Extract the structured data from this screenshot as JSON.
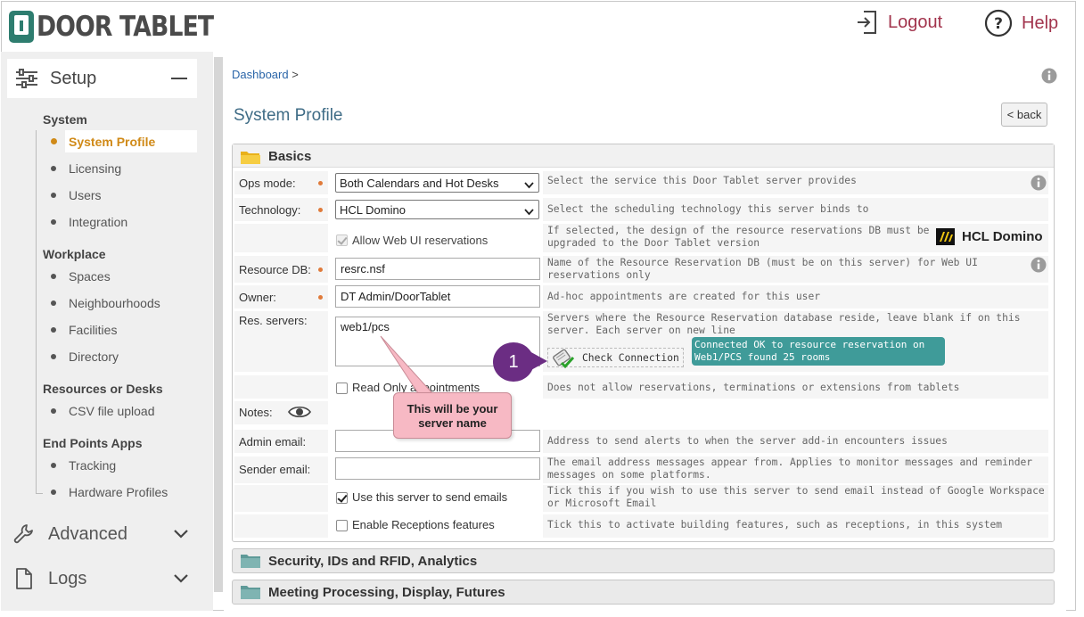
{
  "header": {
    "logo_text": "DOOR TABLET",
    "logout_label": "Logout",
    "help_label": "Help"
  },
  "sidebar": {
    "setup_label": "Setup",
    "sections": [
      {
        "label": "System",
        "items": [
          "System Profile",
          "Licensing",
          "Users",
          "Integration"
        ]
      },
      {
        "label": "Workplace",
        "items": [
          "Spaces",
          "Neighbourhoods",
          "Facilities",
          "Directory"
        ]
      },
      {
        "label": "Resources or Desks",
        "items": [
          "CSV file upload"
        ]
      },
      {
        "label": "End Points Apps",
        "items": [
          "Tracking",
          "Hardware Profiles"
        ]
      }
    ],
    "active_item": "System Profile",
    "advanced_label": "Advanced",
    "logs_label": "Logs"
  },
  "main": {
    "breadcrumb": "Dashboard",
    "breadcrumb_sep": ">",
    "page_title": "System Profile",
    "back_label": "< back",
    "basics_title": "Basics",
    "fields": {
      "ops_mode": {
        "label": "Ops mode:",
        "value": "Both Calendars and Hot Desks",
        "help": "Select the service this Door Tablet server provides"
      },
      "technology": {
        "label": "Technology:",
        "value": "HCL Domino",
        "help": "Select the scheduling technology this server binds to"
      },
      "allow_web": {
        "label": "Allow Web UI reservations",
        "checked": true,
        "help": "If selected, the design of the resource reservations DB must be upgraded to the Door Tablet version",
        "brand": "HCL Domino"
      },
      "resource_db": {
        "label": "Resource DB:",
        "value": "resrc.nsf",
        "help": "Name of the Resource Reservation DB (must be on this server) for Web UI reservations only"
      },
      "owner": {
        "label": "Owner:",
        "value": "DT Admin/DoorTablet",
        "help": "Ad-hoc appointments are created for this user"
      },
      "res_servers": {
        "label": "Res. servers:",
        "value": "web1/pcs",
        "help": "Servers where the Resource Reservation database reside, leave blank if on this server. Each server on new line",
        "check_label": "Check Connection",
        "status": "Connected OK to resource reservation on Web1/PCS found 25 rooms"
      },
      "read_only": {
        "label": "Read Only appointments",
        "checked": false,
        "help": "Does not allow reservations, terminations or extensions from tablets"
      },
      "notes": {
        "label": "Notes:"
      },
      "admin_email": {
        "label": "Admin email:",
        "value": "",
        "help": "Address to send alerts to when the server add-in encounters issues"
      },
      "sender_email": {
        "label": "Sender email:",
        "value": "",
        "help": "The email address messages appear from. Applies to monitor messages and reminder messages on some platforms."
      },
      "use_server_email": {
        "label": "Use this server to send emails",
        "checked": true,
        "help": "Tick this if you wish to use this server to send email instead of Google Workspace or Microsoft Email"
      },
      "receptions": {
        "label": "Enable Receptions features",
        "checked": false,
        "help": "Tick this to activate building features, such as receptions, in this system"
      }
    },
    "collapsed_panels": [
      "Security, IDs and RFID, Analytics",
      "Meeting Processing, Display, Futures"
    ]
  },
  "annotations": {
    "callout_number": "1",
    "note_text": "This will be your server name"
  },
  "colors": {
    "brand_teal": "#2e7d6f",
    "link_red": "#a2344d",
    "active_orange": "#d08a18",
    "status_teal": "#3f9b99",
    "callout_purple": "#6b2d83",
    "note_pink": "#f7b9c4"
  }
}
